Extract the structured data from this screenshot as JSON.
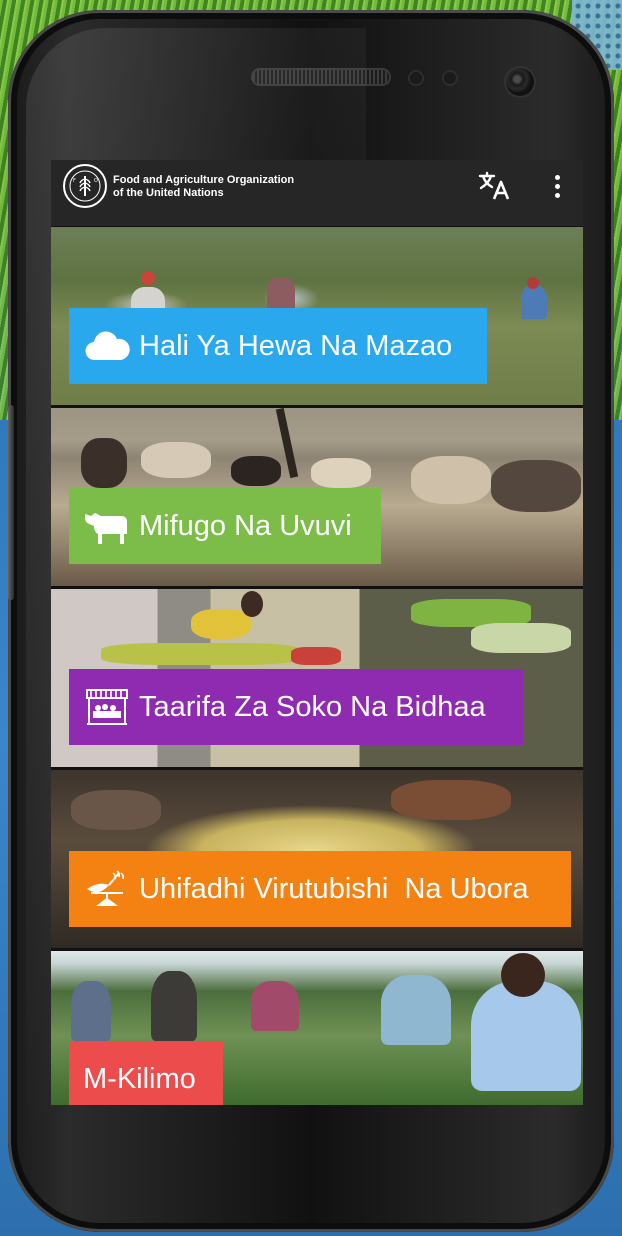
{
  "app": {
    "org_name_line1": "Food and Agriculture Organization",
    "org_name_line2": "of the United Nations",
    "logo_text": "FAO"
  },
  "toolbar": {
    "translate_icon": "translate-icon",
    "overflow_icon": "more-vert-icon"
  },
  "menu": {
    "items": [
      {
        "label": "Hali Ya Hewa Na Mazao",
        "icon": "cloud-icon",
        "color": "#29a8ee"
      },
      {
        "label": "Mifugo Na Uvuvi",
        "icon": "cow-icon",
        "color": "#7bbd48"
      },
      {
        "label": "Taarifa Za Soko Na Bidhaa",
        "icon": "market-stall-icon",
        "color": "#8e2bb0"
      },
      {
        "label": "Uhifadhi Virutubishi  Na Ubora",
        "icon": "nutrition-scale-icon",
        "color": "#f38212"
      },
      {
        "label": "M-Kilimo",
        "icon": "",
        "color": "#ed4c4c"
      }
    ]
  },
  "colors": {
    "appbar_background": "#262626",
    "screen_background": "#111111"
  }
}
